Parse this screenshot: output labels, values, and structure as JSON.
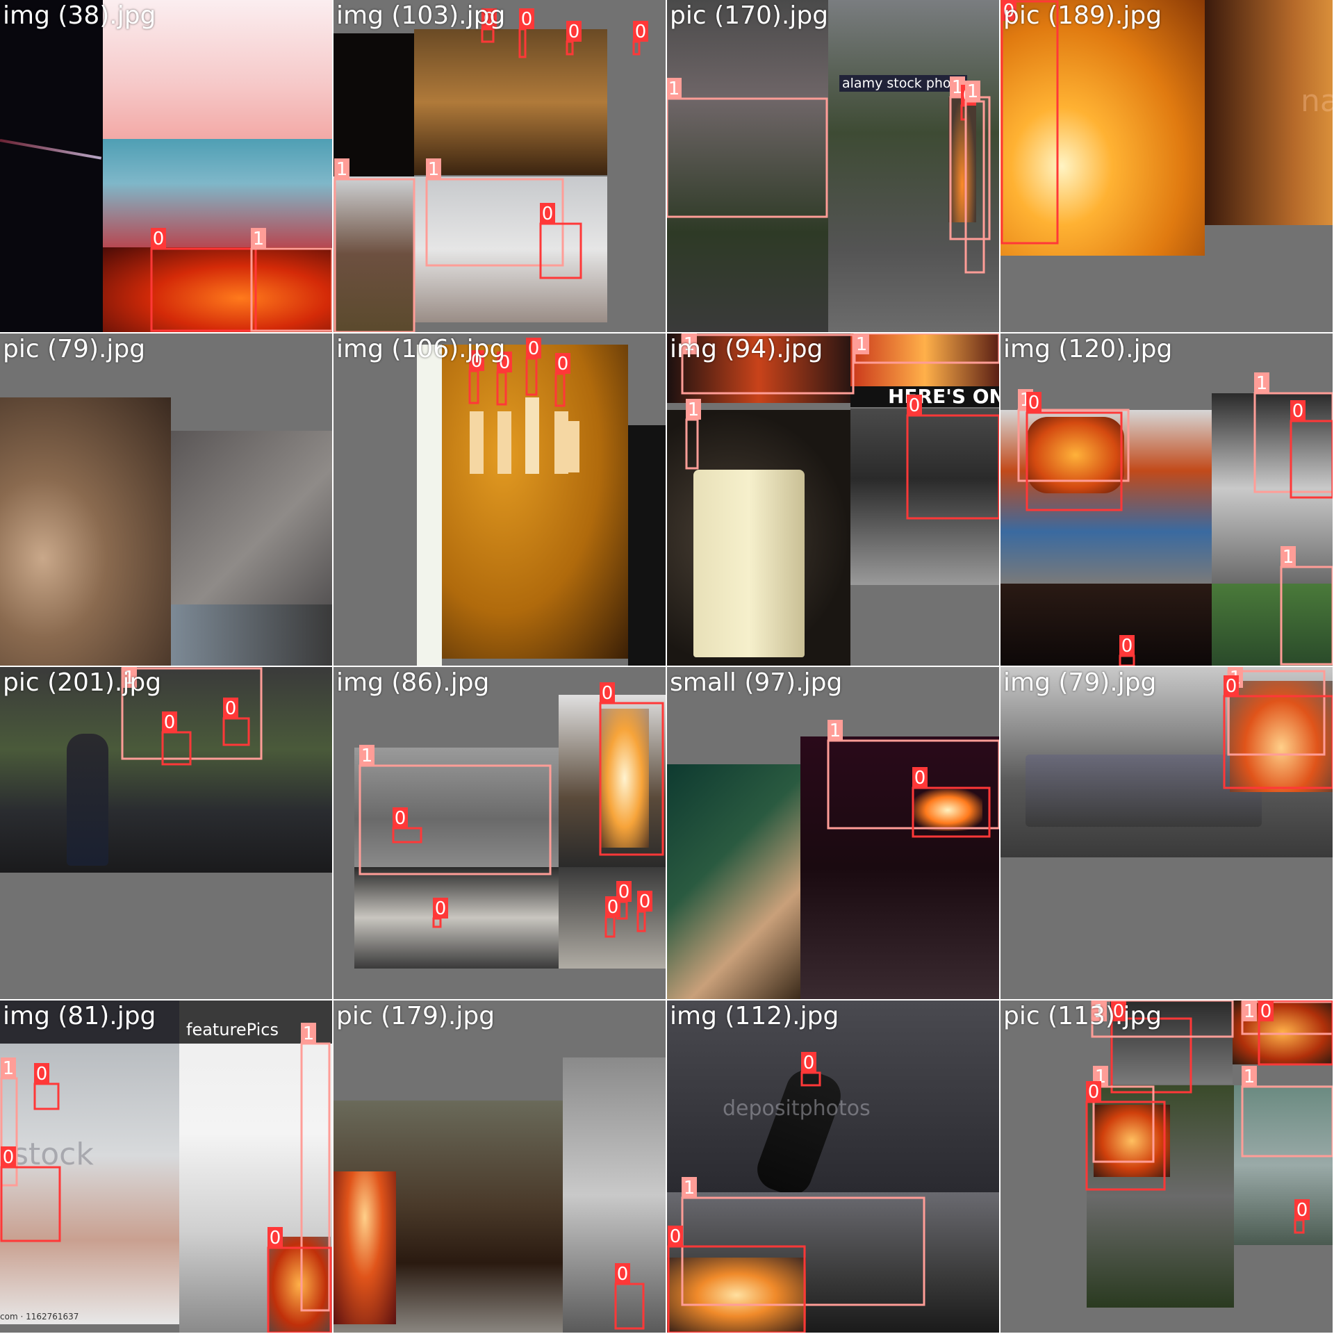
{
  "class_colors": {
    "0": "#ff3838",
    "1": "#ff9d97"
  },
  "tiles": [
    {
      "filename": "img (38).jpg",
      "boxes": [
        {
          "cls": "0"
        },
        {
          "cls": "1"
        }
      ]
    },
    {
      "filename": "img (103).jpg",
      "boxes": [
        {
          "cls": "0"
        },
        {
          "cls": "0"
        },
        {
          "cls": "0"
        },
        {
          "cls": "0"
        },
        {
          "cls": "1"
        },
        {
          "cls": "1"
        },
        {
          "cls": "0"
        }
      ]
    },
    {
      "filename": "pic (170).jpg",
      "watermark": "alamy stock photo",
      "boxes": [
        {
          "cls": "1"
        },
        {
          "cls": "1"
        },
        {
          "cls": "0"
        },
        {
          "cls": "1"
        },
        {
          "cls": "0"
        }
      ]
    },
    {
      "filename": "pic (189).jpg",
      "watermark": "na",
      "boxes": [
        {
          "cls": "0"
        }
      ]
    },
    {
      "filename": "pic (79).jpg",
      "boxes": []
    },
    {
      "filename": "img (106).jpg",
      "boxes": [
        {
          "cls": "0"
        },
        {
          "cls": "0"
        },
        {
          "cls": "0"
        },
        {
          "cls": "0"
        },
        {
          "cls": "0"
        }
      ]
    },
    {
      "filename": "img (94).jpg",
      "watermark": "HERE'S ONE NO",
      "boxes": [
        {
          "cls": "1"
        },
        {
          "cls": "0"
        },
        {
          "cls": "1"
        },
        {
          "cls": "0"
        },
        {
          "cls": "0"
        },
        {
          "cls": "1"
        }
      ]
    },
    {
      "filename": "img (120).jpg",
      "boxes": [
        {
          "cls": "1"
        },
        {
          "cls": "0"
        },
        {
          "cls": "1"
        },
        {
          "cls": "0"
        },
        {
          "cls": "1"
        },
        {
          "cls": "0"
        }
      ]
    },
    {
      "filename": "pic (201).jpg",
      "boxes": [
        {
          "cls": "1"
        },
        {
          "cls": "0"
        },
        {
          "cls": "0"
        }
      ]
    },
    {
      "filename": "img (86).jpg",
      "boxes": [
        {
          "cls": "1"
        },
        {
          "cls": "0"
        },
        {
          "cls": "0"
        },
        {
          "cls": "0"
        },
        {
          "cls": "0"
        },
        {
          "cls": "0"
        },
        {
          "cls": "0"
        }
      ]
    },
    {
      "filename": "small (97).jpg",
      "boxes": [
        {
          "cls": "1"
        },
        {
          "cls": "0"
        }
      ]
    },
    {
      "filename": "img (79).jpg",
      "boxes": [
        {
          "cls": "1"
        },
        {
          "cls": "0"
        }
      ]
    },
    {
      "filename": "img (81).jpg",
      "watermark": "featurePics",
      "watermark2": "rstock",
      "watermark3": "com · 1162761637",
      "boxes": [
        {
          "cls": "0"
        },
        {
          "cls": "1"
        },
        {
          "cls": "1"
        },
        {
          "cls": "0"
        },
        {
          "cls": "0"
        }
      ]
    },
    {
      "filename": "pic (179).jpg",
      "boxes": [
        {
          "cls": "0"
        }
      ]
    },
    {
      "filename": "img (112).jpg",
      "watermark": "depositphotos",
      "boxes": [
        {
          "cls": "0"
        },
        {
          "cls": "1"
        },
        {
          "cls": "0"
        }
      ]
    },
    {
      "filename": "pic (113).jpg",
      "boxes": [
        {
          "cls": "0"
        },
        {
          "cls": "1"
        },
        {
          "cls": "1"
        },
        {
          "cls": "0"
        },
        {
          "cls": "1"
        },
        {
          "cls": "0"
        },
        {
          "cls": "1"
        },
        {
          "cls": "0"
        }
      ]
    }
  ]
}
